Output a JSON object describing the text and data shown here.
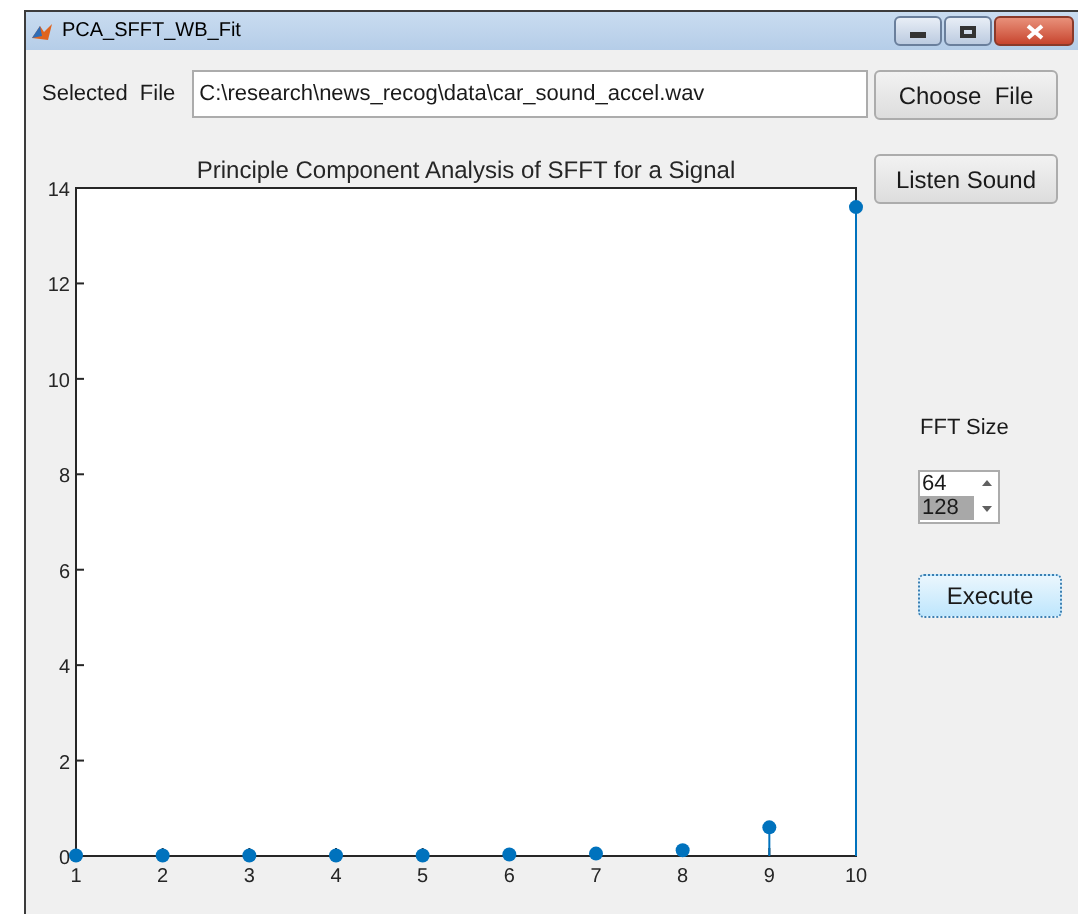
{
  "window": {
    "title": "PCA_SFFT_WB_Fit"
  },
  "file": {
    "label": "Selected  File",
    "value": "C:\\research\\news_recog\\data\\car_sound_accel.wav"
  },
  "buttons": {
    "choose": "Choose  File",
    "listen": "Listen Sound",
    "execute": "Execute"
  },
  "fft": {
    "label": "FFT Size",
    "options": [
      {
        "label": "64",
        "selected": false
      },
      {
        "label": "128",
        "selected": true
      }
    ]
  },
  "chart": {
    "chart_data": {
      "type": "scatter",
      "title": "Principle Component Analysis of SFFT for a Signal",
      "x": [
        1,
        2,
        3,
        4,
        5,
        6,
        7,
        8,
        9,
        10
      ],
      "series": [
        {
          "color": "#0072bd",
          "values": [
            0.01,
            0.01,
            0.01,
            0.01,
            0.01,
            0.03,
            0.05,
            0.12,
            0.6,
            13.6
          ]
        }
      ],
      "xlim": [
        1,
        10
      ],
      "ylim": [
        0,
        14
      ],
      "xticks": [
        1,
        2,
        3,
        4,
        5,
        6,
        7,
        8,
        9,
        10
      ],
      "yticks": [
        0,
        2,
        4,
        6,
        8,
        10,
        12,
        14
      ]
    }
  }
}
